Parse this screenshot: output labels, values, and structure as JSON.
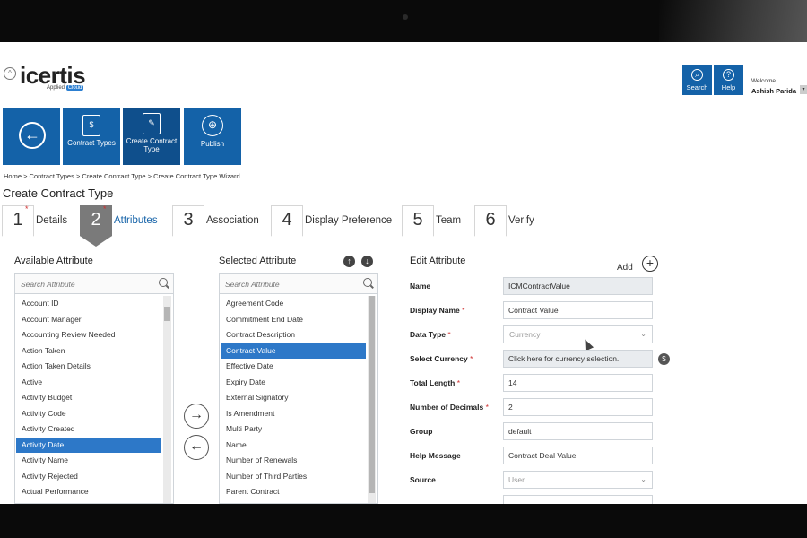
{
  "logo": {
    "word": "icertis",
    "tag_prefix": "Applied",
    "tag_badge": "Cloud"
  },
  "top_buttons": {
    "search": "Search",
    "help": "Help"
  },
  "user": {
    "welcome": "Welcome",
    "name": "Ashish Parida"
  },
  "toolbar": {
    "contract_types": "Contract Types",
    "create_contract_type": "Create Contract Type",
    "publish": "Publish"
  },
  "breadcrumb": "Home > Contract Types > Create Contract Type > Create Contract Type Wizard",
  "page_title": "Create Contract Type",
  "steps": [
    {
      "num": "1",
      "label": "Details"
    },
    {
      "num": "2",
      "label": "Attributes"
    },
    {
      "num": "3",
      "label": "Association"
    },
    {
      "num": "4",
      "label": "Display Preference"
    },
    {
      "num": "5",
      "label": "Team"
    },
    {
      "num": "6",
      "label": "Verify"
    }
  ],
  "available": {
    "title": "Available Attribute",
    "placeholder": "Search Attribute",
    "items": [
      "Account ID",
      "Account Manager",
      "Accounting Review Needed",
      "Action Taken",
      "Action Taken Details",
      "Active",
      "Activity Budget",
      "Activity Code",
      "Activity Created",
      "Activity Date",
      "Activity Name",
      "Activity Rejected",
      "Actual Performance"
    ],
    "selected": "Activity Date"
  },
  "selected_attr": {
    "title": "Selected Attribute",
    "placeholder": "Search Attribute",
    "items": [
      "Agreement Code",
      "Commitment End Date",
      "Contract Description",
      "Contract Value",
      "Effective Date",
      "Expiry Date",
      "External Signatory",
      "Is Amendment",
      "Multi Party",
      "Name",
      "Number of Renewals",
      "Number of Third Parties",
      "Parent Contract"
    ],
    "selected": "Contract Value"
  },
  "edit": {
    "title": "Edit  Attribute",
    "add_label": "Add",
    "fields": {
      "name": {
        "label": "Name",
        "value": "ICMContractValue"
      },
      "display_name": {
        "label": "Display Name",
        "value": "Contract Value"
      },
      "data_type": {
        "label": "Data Type",
        "value": "Currency"
      },
      "select_currency": {
        "label": "Select Currency",
        "value": "Click here for currency selection."
      },
      "total_length": {
        "label": "Total Length",
        "value": "14"
      },
      "decimals": {
        "label": "Number of Decimals",
        "value": "2"
      },
      "group": {
        "label": "Group",
        "value": "default"
      },
      "help_message": {
        "label": "Help Message",
        "value": "Contract Deal Value"
      },
      "source": {
        "label": "Source",
        "value": "User"
      }
    },
    "required_mark": "*"
  },
  "colors": {
    "brand": "#1462a8",
    "selection": "#2d78c8",
    "required": "#d03030"
  }
}
